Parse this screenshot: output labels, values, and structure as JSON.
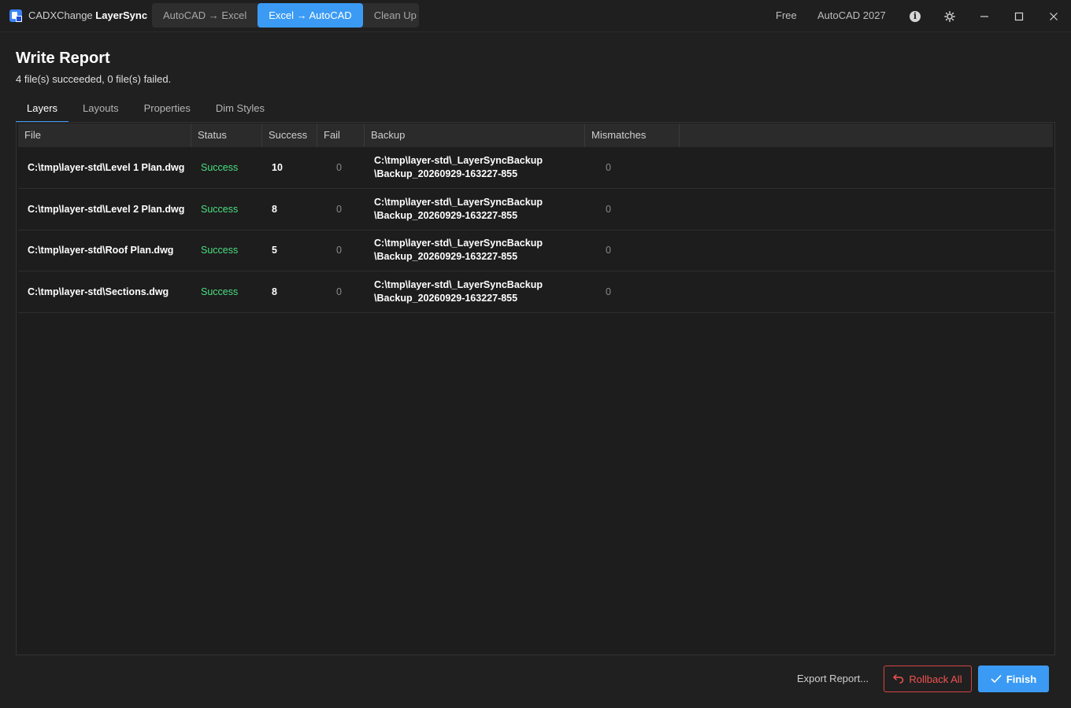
{
  "app": {
    "name_prefix": "CADXChange",
    "name_suffix": "LayerSync",
    "modes": [
      "AutoCAD → Excel",
      "Excel → AutoCAD",
      "Clean Up"
    ],
    "active_mode": 1,
    "license": "Free",
    "cad_version": "AutoCAD 2027",
    "icons": [
      "app-logo-icon",
      "info-icon",
      "theme-sun-icon",
      "minimize-icon",
      "maximize-icon",
      "close-icon"
    ]
  },
  "report": {
    "title": "Write Report",
    "summary": "4 file(s) succeeded, 0 file(s) failed."
  },
  "tabs": [
    "Layers",
    "Layouts",
    "Properties",
    "Dim Styles"
  ],
  "active_tab": 0,
  "table": {
    "columns": [
      "File",
      "Status",
      "Success",
      "Fail",
      "Backup",
      "Mismatches"
    ],
    "rows": [
      {
        "file": "C:\\tmp\\layer-std\\Level 1 Plan.dwg",
        "status": "Success",
        "success": "10",
        "fail": "0",
        "backup_line1": "C:\\tmp\\layer-std\\_LayerSyncBackup",
        "backup_line2": "\\Backup_20260929-163227-855",
        "mismatches": "0"
      },
      {
        "file": "C:\\tmp\\layer-std\\Level 2 Plan.dwg",
        "status": "Success",
        "success": "8",
        "fail": "0",
        "backup_line1": "C:\\tmp\\layer-std\\_LayerSyncBackup",
        "backup_line2": "\\Backup_20260929-163227-855",
        "mismatches": "0"
      },
      {
        "file": "C:\\tmp\\layer-std\\Roof Plan.dwg",
        "status": "Success",
        "success": "5",
        "fail": "0",
        "backup_line1": "C:\\tmp\\layer-std\\_LayerSyncBackup",
        "backup_line2": "\\Backup_20260929-163227-855",
        "mismatches": "0"
      },
      {
        "file": "C:\\tmp\\layer-std\\Sections.dwg",
        "status": "Success",
        "success": "8",
        "fail": "0",
        "backup_line1": "C:\\tmp\\layer-std\\_LayerSyncBackup",
        "backup_line2": "\\Backup_20260929-163227-855",
        "mismatches": "0"
      }
    ]
  },
  "footer": {
    "export_label": "Export Report...",
    "rollback_label": "Rollback All",
    "finish_label": "Finish"
  },
  "colors": {
    "accent": "#3b9bf4",
    "success": "#4ade80",
    "danger": "#f05252",
    "background": "#202020"
  }
}
